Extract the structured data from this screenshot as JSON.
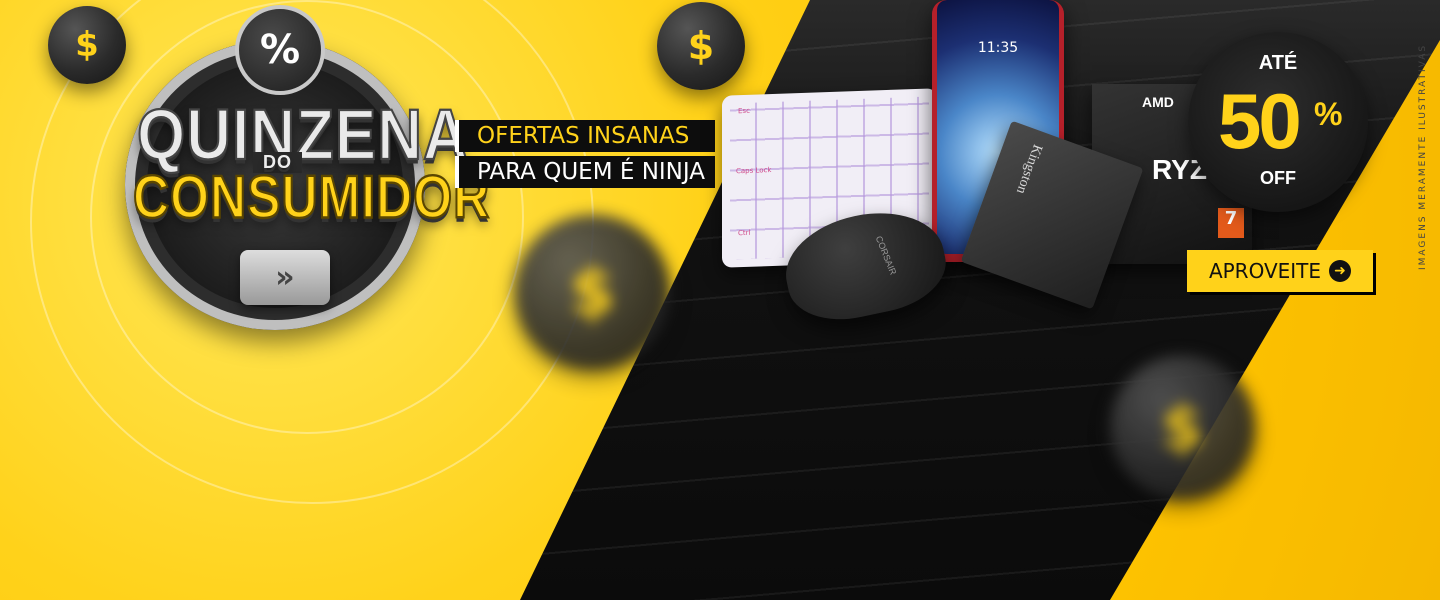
{
  "logo": {
    "badge_symbol": "%",
    "line1": "QUINZENA",
    "line2": "DO",
    "line3": "CONSUMIDOR",
    "arrow": "»"
  },
  "tagline": {
    "line1": "OFERTAS INSANAS",
    "line2": "PARA QUEM É NINJA"
  },
  "coins": {
    "symbol": "$"
  },
  "products": {
    "phone_clock": "11:35",
    "ssd_brand": "Kingston",
    "mouse_brand": "CORSAIR",
    "cpu_brand": "AMD",
    "cpu_name": "RYZ",
    "cpu_badge": "7",
    "keyboard_keys": [
      "Esc",
      "Caps Lock",
      "Ctrl"
    ]
  },
  "discount": {
    "prefix": "ATÉ",
    "number": "50",
    "percent": "%",
    "suffix": "OFF"
  },
  "cta": {
    "label": "APROVEITE",
    "icon": "➜"
  },
  "disclaimer": "IMAGENS MERAMENTE ILUSTRATIVAS",
  "colors": {
    "brand_yellow": "#ffd21a",
    "dark": "#0d0d0d"
  }
}
